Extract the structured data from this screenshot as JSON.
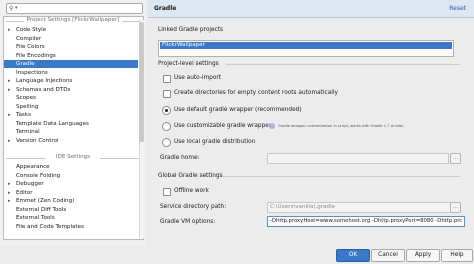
{
  "sidebar": {
    "search_icon": "search-icon",
    "project_header": "Project Settings [FlickrWallpaper]",
    "ide_header": "IDE Settings",
    "project_items": [
      {
        "label": "Code Style",
        "expandable": true
      },
      {
        "label": "Compiler",
        "expandable": false
      },
      {
        "label": "File Colors",
        "expandable": false
      },
      {
        "label": "File Encodings",
        "expandable": false
      },
      {
        "label": "Gradle",
        "expandable": false,
        "selected": true
      },
      {
        "label": "Inspections",
        "expandable": false
      },
      {
        "label": "Language Injections",
        "expandable": true
      },
      {
        "label": "Schemas and DTDs",
        "expandable": true
      },
      {
        "label": "Scopes",
        "expandable": false
      },
      {
        "label": "Spelling",
        "expandable": false
      },
      {
        "label": "Tasks",
        "expandable": true
      },
      {
        "label": "Template Data Languages",
        "expandable": false
      },
      {
        "label": "Terminal",
        "expandable": false
      },
      {
        "label": "Version Control",
        "expandable": true
      }
    ],
    "ide_items": [
      {
        "label": "Appearance",
        "expandable": false
      },
      {
        "label": "Console Folding",
        "expandable": false
      },
      {
        "label": "Debugger",
        "expandable": true
      },
      {
        "label": "Editor",
        "expandable": true
      },
      {
        "label": "Emmet (Zen Coding)",
        "expandable": true
      },
      {
        "label": "External Diff Tools",
        "expandable": false
      },
      {
        "label": "External Tools",
        "expandable": false
      },
      {
        "label": "File and Code Templates",
        "expandable": false
      }
    ]
  },
  "header": {
    "title": "Gradle",
    "reset": "Reset"
  },
  "linked": {
    "title": "Linked Gradle projects",
    "project": "FlickrWallpaper"
  },
  "project_level": {
    "title": "Project-level settings",
    "auto_import": "Use auto-import",
    "create_dirs": "Create directories for empty content roots automatically",
    "default_wrapper": "Use default gradle wrapper (recommended)",
    "custom_wrapper": "Use customizable gradle wrapper",
    "custom_wrapper_hint": "Gradle wrapper customization in script, works with Gradle 1.7 or later",
    "local_distribution": "Use local gradle distribution",
    "gradle_home_label": "Gradle home:",
    "gradle_home_value": ""
  },
  "global": {
    "title": "Global Gradle settings",
    "offline": "Offline work",
    "service_dir_label": "Service directory path:",
    "service_dir_value": "C:\\Users\\vanilla\\.gradle",
    "vm_options_label": "Gradle VM options:",
    "vm_options_value": "-Dhttp.proxyHost=www.somehost.org -Dhttp.proxyPort=8080 -Dhttp.prc"
  },
  "buttons": {
    "ok": "OK",
    "cancel": "Cancel",
    "apply": "Apply",
    "help": "Help"
  },
  "colors": {
    "selection": "#3a78c8",
    "link": "#2a5db0"
  }
}
